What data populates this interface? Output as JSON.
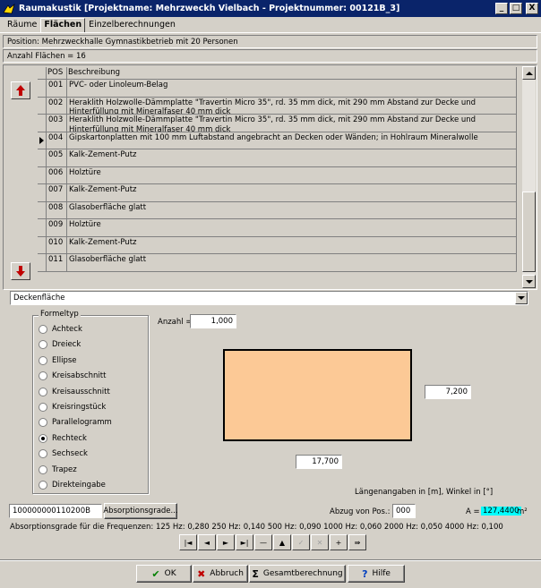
{
  "window": {
    "title": "Raumakustik [Projektname: Mehrzweckh Vielbach - Projektnummer: 00121B_3]",
    "controls": {
      "minimize": "_",
      "maximize": "□",
      "close": "X"
    }
  },
  "tabs": [
    {
      "label": "Räume"
    },
    {
      "label": "Flächen"
    },
    {
      "label": "Einzelberechnungen"
    }
  ],
  "info": {
    "position": "Position:    Mehrzweckhalle Gymnastikbetrieb mit 20 Personen",
    "count": "Anzahl Flächen =    16"
  },
  "table": {
    "headers": {
      "pos": "POS",
      "desc": "Beschreibung"
    },
    "selected_index": 3,
    "rows": [
      {
        "pos": "001",
        "desc": "PVC- oder Linoleum-Belag"
      },
      {
        "pos": "002",
        "desc": "Heraklith Holzwolle-Dämmplatte \"Travertin Micro 35\", rd. 35 mm dick, mit 290 mm Abstand zur Decke und Hinterfüllung mit Mineralfaser 40 mm dick"
      },
      {
        "pos": "003",
        "desc": "Heraklith Holzwolle-Dämmplatte \"Travertin Micro 35\", rd. 35 mm dick, mit 290 mm Abstand zur Decke und Hinterfüllung mit Mineralfaser 40 mm dick"
      },
      {
        "pos": "004",
        "desc": "Gipskartonplatten mit 100 mm Luftabstand angebracht an Decken oder Wänden; in Hohlraum Mineralwolle"
      },
      {
        "pos": "005",
        "desc": "Kalk-Zement-Putz"
      },
      {
        "pos": "006",
        "desc": "Holztüre"
      },
      {
        "pos": "007",
        "desc": "Kalk-Zement-Putz"
      },
      {
        "pos": "008",
        "desc": "Glasoberfläche glatt"
      },
      {
        "pos": "009",
        "desc": "Holztüre"
      },
      {
        "pos": "010",
        "desc": "Kalk-Zement-Putz"
      },
      {
        "pos": "011",
        "desc": "Glasoberfläche glatt"
      }
    ]
  },
  "surface_type": {
    "selected": "Deckenfläche"
  },
  "formeltyp": {
    "title": "Formeltyp",
    "selected": "Rechteck",
    "options": [
      "Achteck",
      "Dreieck",
      "Ellipse",
      "Kreisabschnitt",
      "Kreisausschnitt",
      "Kreisringstück",
      "Parallelogramm",
      "Rechteck",
      "Sechseck",
      "Trapez",
      "Direkteingabe"
    ]
  },
  "geometry": {
    "anzahl_label": "Anzahl =",
    "anzahl": "1,000",
    "height": "7,200",
    "width": "17,700",
    "units_note": "Längenangaben in [m], Winkel in [°]"
  },
  "absorption": {
    "code": "100000000110200B",
    "button": "Absorptionsgrade...",
    "abzug_label": "Abzug von Pos.:",
    "abzug_value": "000",
    "area_label": "A =",
    "area_value": "127,4400",
    "area_unit": "m²",
    "freq_line": "Absorptionsgrade für die Frequenzen: 125 Hz: 0,280    250 Hz: 0,140    500 Hz: 0,090    1000 Hz: 0,060    2000 Hz: 0,050    4000 Hz: 0,100"
  },
  "navigator": {
    "buttons": [
      {
        "name": "first-record-button",
        "glyph": "|◄",
        "enabled": true
      },
      {
        "name": "prior-record-button",
        "glyph": "◄",
        "enabled": true
      },
      {
        "name": "next-record-button",
        "glyph": "►",
        "enabled": true
      },
      {
        "name": "last-record-button",
        "glyph": "►|",
        "enabled": true
      },
      {
        "name": "delete-record-button",
        "glyph": "—",
        "enabled": true
      },
      {
        "name": "edit-record-button",
        "glyph": "▲",
        "enabled": true
      },
      {
        "name": "post-record-button",
        "glyph": "✓",
        "enabled": false
      },
      {
        "name": "cancel-record-button",
        "glyph": "✕",
        "enabled": false
      },
      {
        "name": "insert-record-button",
        "glyph": "+",
        "enabled": true
      },
      {
        "name": "move-record-button",
        "glyph": "⇛",
        "enabled": true
      }
    ]
  },
  "footer": {
    "ok": "OK",
    "cancel": "Abbruch",
    "total": "Gesamtberechnung",
    "help": "Hilfe"
  },
  "colors": {
    "titlebar": "#0a246a",
    "shape_fill": "#fcc996",
    "area_highlight": "#00ffff",
    "arrow_red": "#c00000"
  }
}
